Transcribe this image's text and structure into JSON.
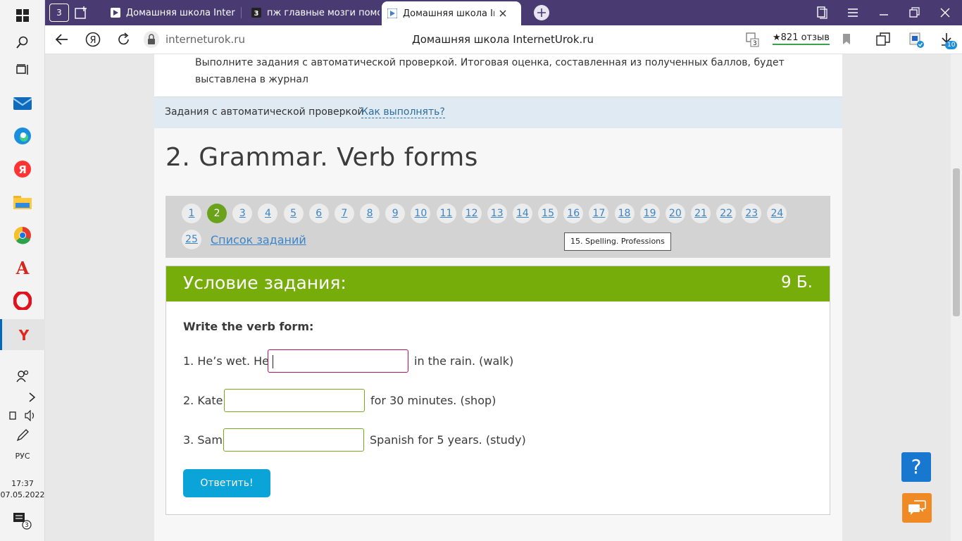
{
  "taskbar": {
    "lang": "РУС",
    "time": "17:37",
    "date": "07.05.2022",
    "notif_count": "3"
  },
  "browser": {
    "tab_count_badge": "3",
    "tabs": [
      {
        "label": "Домашняя школа Internet"
      },
      {
        "label": "пж главные мозги помоги"
      },
      {
        "label": "Домашняя школа Inter"
      }
    ],
    "url": "interneturok.ru",
    "page_title": "Домашняя школа InternetUrok.ru",
    "ext_badge": "3",
    "reviews": "★821 отзыв",
    "downloads_badge": "10"
  },
  "page": {
    "intro_text": "Выполните задания с автоматической проверкой. Итоговая оценка, составленная из полученных баллов, будет выставлена в журнал",
    "auto_label": "Задания с автоматической проверкой",
    "how_link": "Как выполнять?",
    "title": "2. Grammar. Verb forms",
    "nav": {
      "numbers": [
        "1",
        "2",
        "3",
        "4",
        "5",
        "6",
        "7",
        "8",
        "9",
        "10",
        "11",
        "12",
        "13",
        "14",
        "15",
        "16",
        "17",
        "18",
        "19",
        "20",
        "21",
        "22",
        "23",
        "24",
        "25"
      ],
      "active": "2",
      "list_link": "Список заданий",
      "tooltip": "15. Spelling. Professions"
    },
    "task": {
      "heading": "Условие задания:",
      "score": "9 Б.",
      "instruction": "Write the verb form:",
      "lines": [
        {
          "before": "1. He’s wet. He",
          "after": "in the rain. (walk)",
          "value": ""
        },
        {
          "before": "2. Kate",
          "after": "for 30 minutes. (shop)",
          "value": ""
        },
        {
          "before": "3. Sam",
          "after": "Spanish for 5 years. (study)",
          "value": ""
        }
      ],
      "submit": "Ответить!"
    },
    "help_label": "?"
  }
}
